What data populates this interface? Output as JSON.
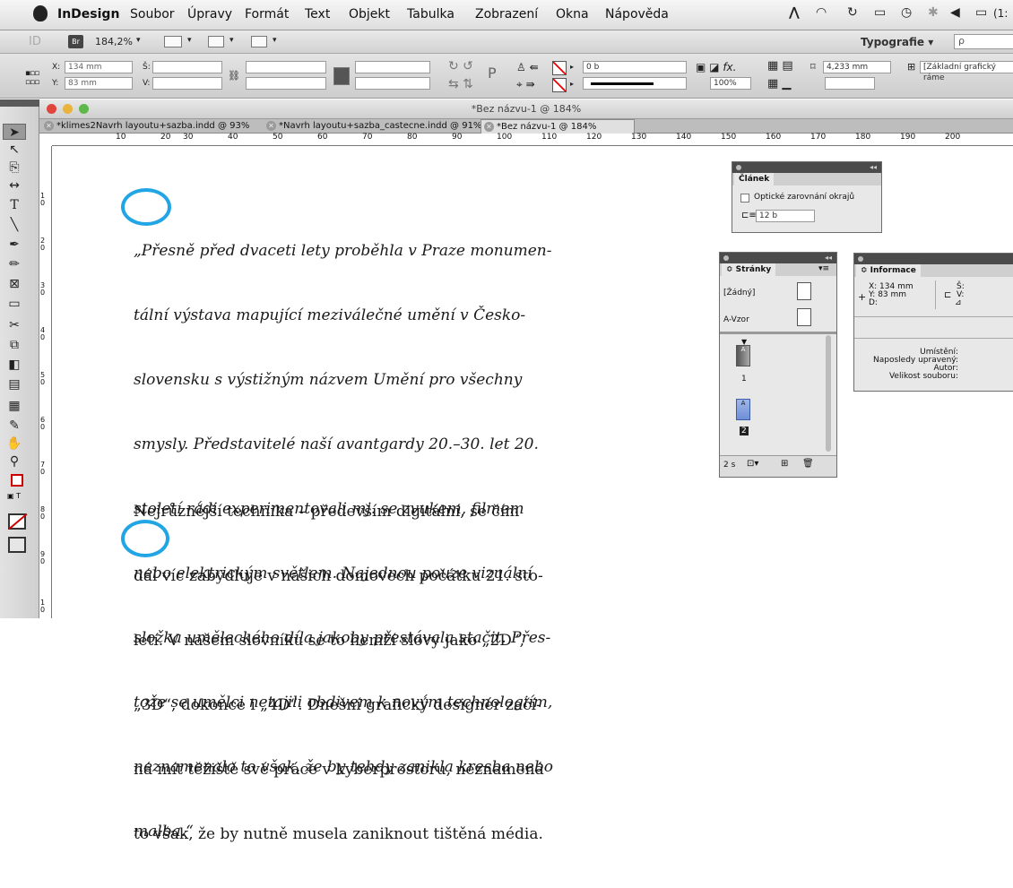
{
  "menubar": {
    "app": "InDesign",
    "items": [
      "Soubor",
      "Úpravy",
      "Formát",
      "Text",
      "Objekt",
      "Tabulka",
      "Zobrazení",
      "Okna",
      "Nápověda"
    ],
    "clock": "(1:"
  },
  "appbar": {
    "logo": "ID",
    "bridge": "Br",
    "zoom": "184,2%",
    "workspace": "Typografie ▾",
    "search_placeholder": "ρ"
  },
  "control": {
    "x_label": "X:",
    "x_value": "134 mm",
    "y_label": "Y:",
    "y_value": "83 mm",
    "w_label": "Š:",
    "h_label": "V:",
    "stroke_weight": "0 b",
    "opacity": "100%",
    "dimension": "4,233 mm",
    "style": "[Základní grafický ráme"
  },
  "window": {
    "title": "*Bez názvu-1 @ 184%"
  },
  "tabs": [
    {
      "label": "*klimes2Navrh layoutu+sazba.indd @ 93%"
    },
    {
      "label": "*Navrh layoutu+sazba_castecne.indd @ 91%"
    },
    {
      "label": "*Bez názvu-1 @ 184%"
    }
  ],
  "ruler": {
    "h": [
      "10",
      "20",
      "30",
      "40",
      "50",
      "60",
      "70",
      "80",
      "90",
      "100",
      "110",
      "120",
      "130",
      "140",
      "150",
      "160",
      "170",
      "180",
      "190",
      "200"
    ],
    "v": [
      "1\n0",
      "2\n0",
      "3\n0",
      "4\n0",
      "5\n0",
      "6\n0",
      "7\n0",
      "8\n0",
      "9\n0",
      "1\n0"
    ]
  },
  "text": {
    "quote": [
      "„Přesně před dvaceti lety proběhla v Praze monumen-",
      "tální výstava mapující meziválečné umění v Česko-",
      "slovensku s výstižným názvem Umění pro všechny",
      "smysly. Představitelé naší avantgardy 20.–30. let 20.",
      "století rádi experimentovali mj. se zvukem, filmem",
      "nebo elektrickým světlem. Najednou pouze vizuální",
      "složka uměleckého díla jakoby přestávala stačit. Přes-",
      "tože se umělci netajili obdivem k novým technologiím,",
      "neznamenalo to však, že by tehdy zanikla kresba nebo",
      "malba.“"
    ],
    "body": [
      "Nejrůznější technika – především digitální, se čím",
      "dál víc zabydluje v našich domovech počátku 21. sto-",
      "letí. V našem slovníku se to hemží slovy jako „2D“,",
      "„3D“, dokonce i „4D“. Dnešní grafický designér začí-",
      "ná mít těžiště své práce v kyberprostoru, neznamená",
      "to však, že by nutně musela zaniknout tištěná média."
    ]
  },
  "panel_clanek": {
    "title": "Článek",
    "checkbox": "Optické zarovnání okrajů",
    "size": "12 b"
  },
  "panel_stranky": {
    "title": "≎ Stránky",
    "none": "[Žádný]",
    "master": "A-Vzor",
    "page1": "1",
    "page2": "2",
    "count": "2 s"
  },
  "panel_info": {
    "title": "≎ Informace",
    "x": "X: 134 mm",
    "y": "Y: 83 mm",
    "d": "D:",
    "s": "Š:",
    "v": "V:",
    "labels": [
      "Umístění:",
      "Naposledy upravený:",
      "Autor:",
      "Velikost souboru:"
    ]
  }
}
